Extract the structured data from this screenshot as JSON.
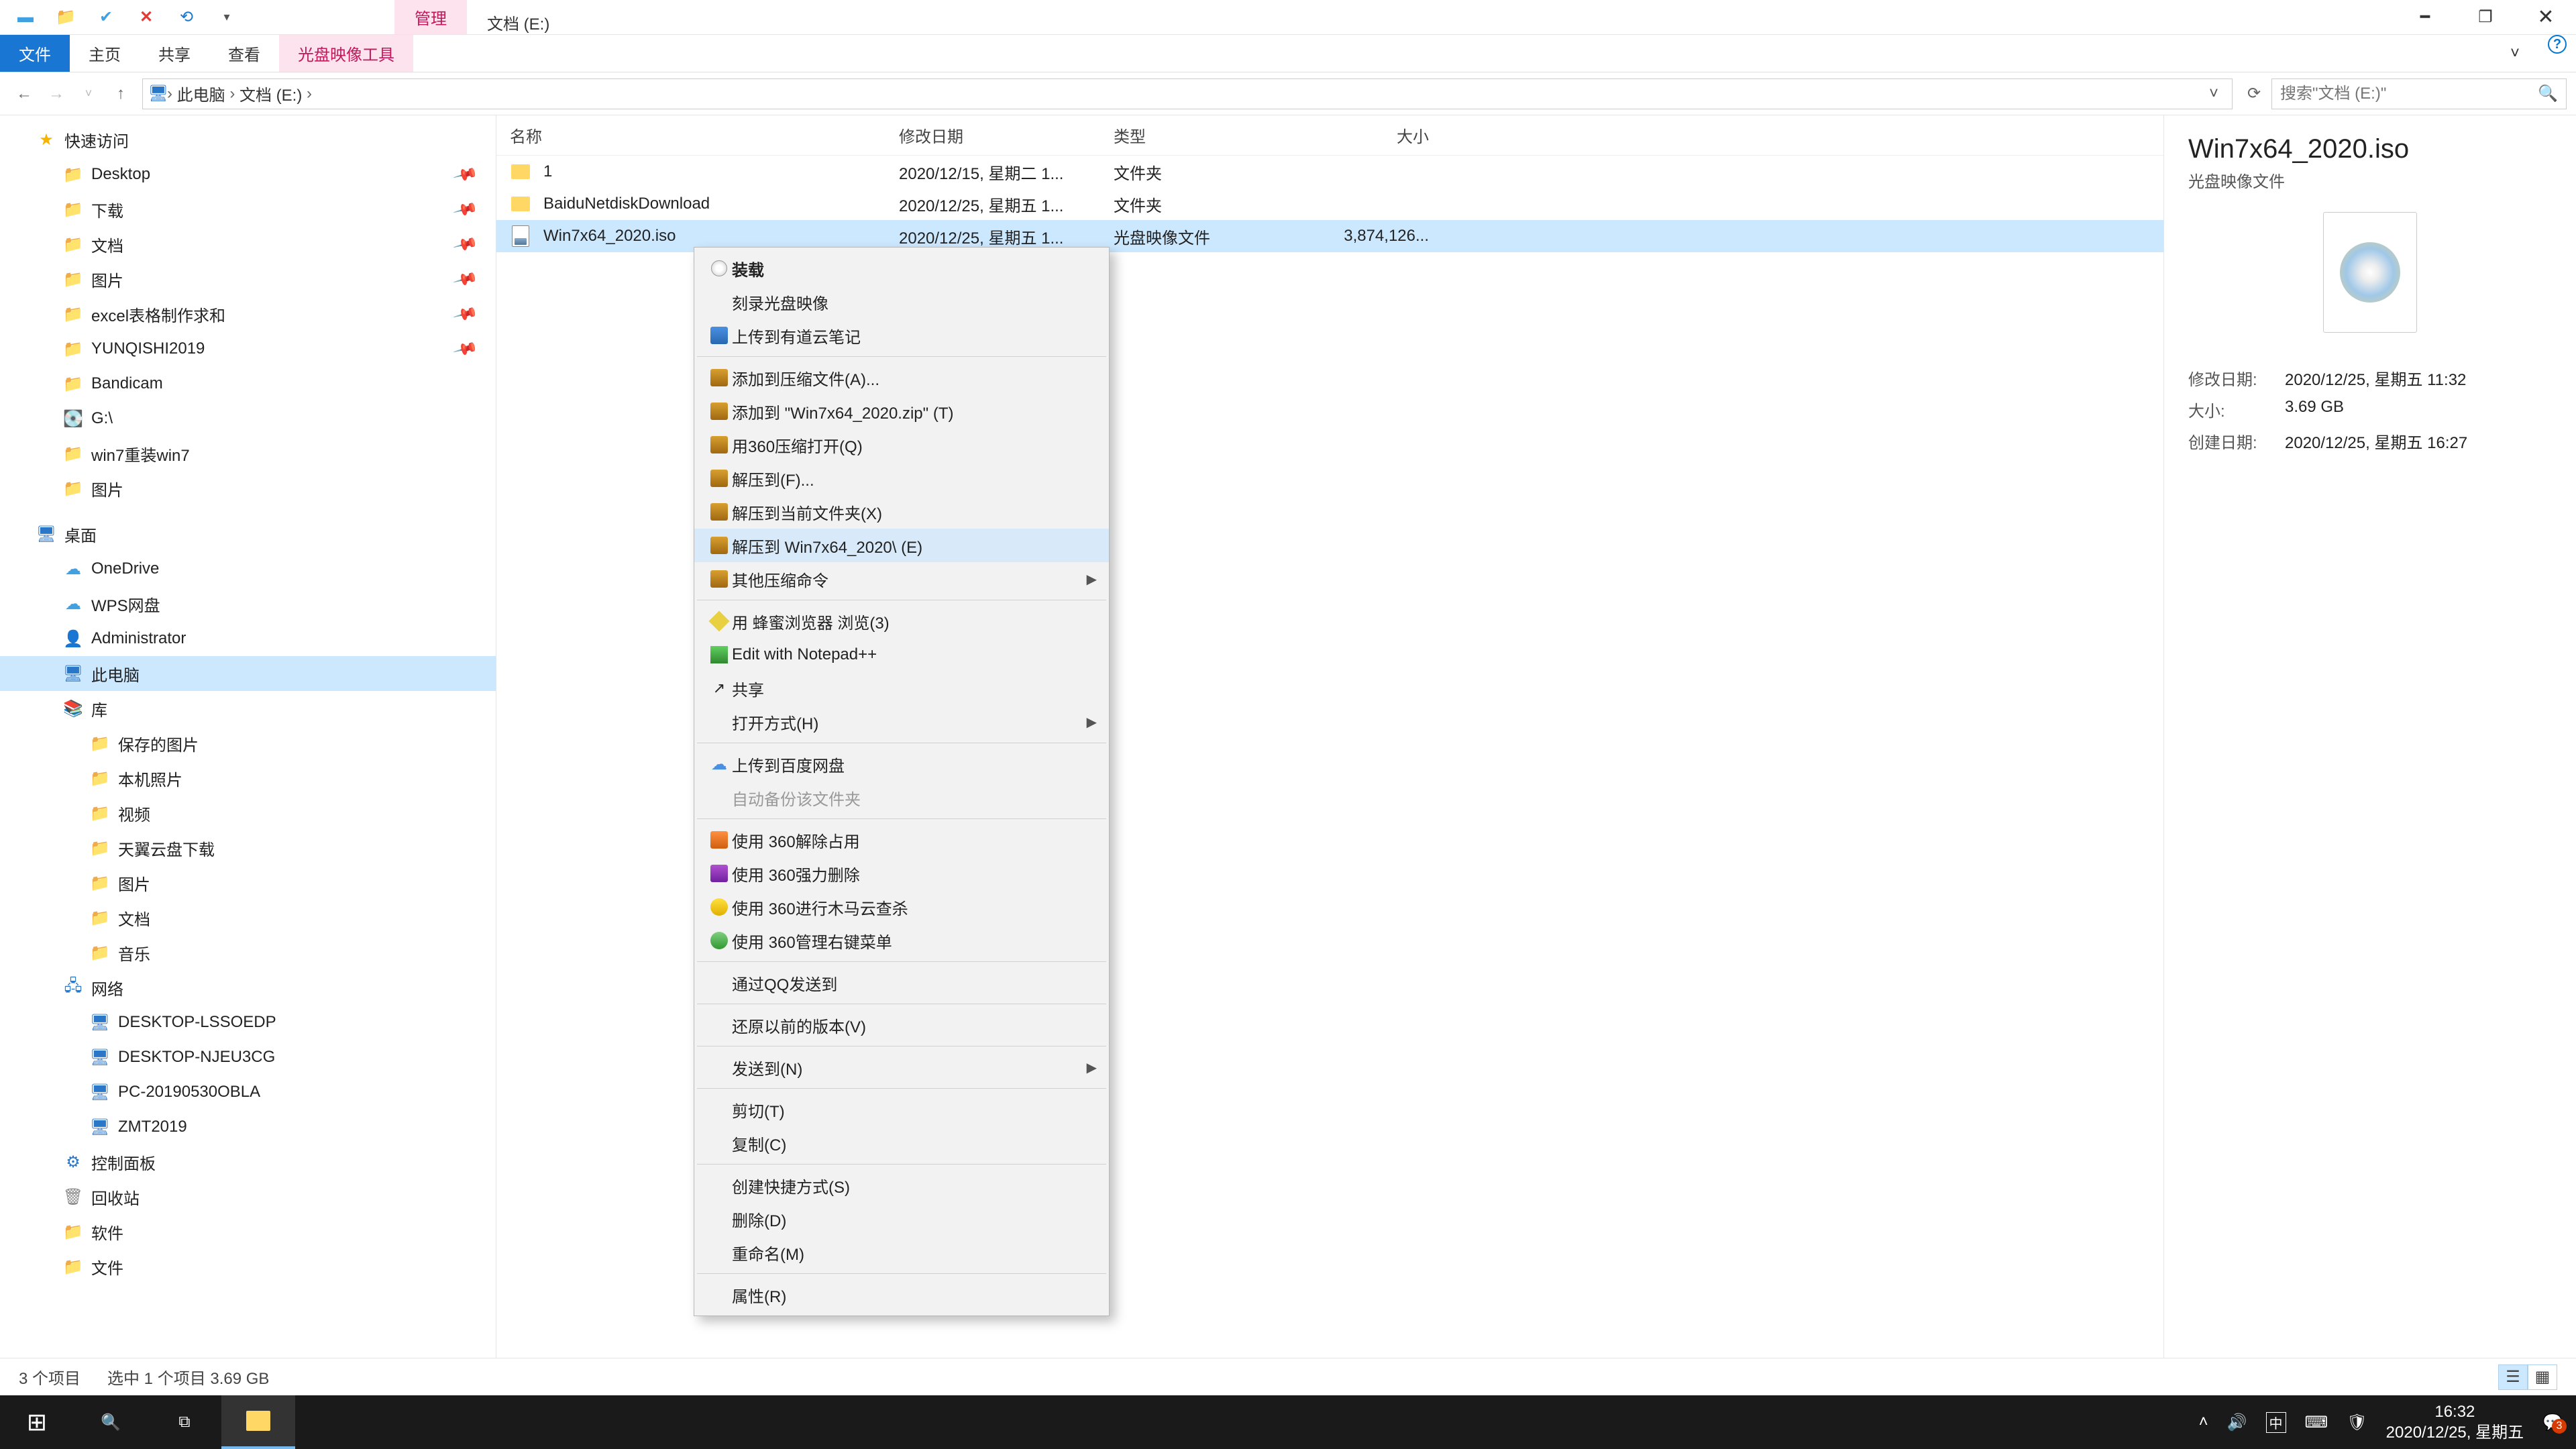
{
  "title": "文档 (E:)",
  "context_tab": "管理",
  "ribbon": {
    "file": "文件",
    "home": "主页",
    "share": "共享",
    "view": "查看",
    "disc": "光盘映像工具"
  },
  "breadcrumb": {
    "pc": "此电脑",
    "drive": "文档 (E:)"
  },
  "search_placeholder": "搜索\"文档 (E:)\"",
  "columns": {
    "name": "名称",
    "date": "修改日期",
    "type": "类型",
    "size": "大小"
  },
  "files": [
    {
      "name": "1",
      "date": "2020/12/15, 星期二 1...",
      "type": "文件夹",
      "size": "",
      "icon": "folder"
    },
    {
      "name": "BaiduNetdiskDownload",
      "date": "2020/12/25, 星期五 1...",
      "type": "文件夹",
      "size": "",
      "icon": "folder"
    },
    {
      "name": "Win7x64_2020.iso",
      "date": "2020/12/25, 星期五 1...",
      "type": "光盘映像文件",
      "size": "3,874,126...",
      "icon": "iso",
      "sel": true
    }
  ],
  "sidebar": [
    {
      "t": "快速访问",
      "ic": "star",
      "l": 1
    },
    {
      "t": "Desktop",
      "ic": "fold",
      "l": 2,
      "pin": true
    },
    {
      "t": "下载",
      "ic": "fold",
      "l": 2,
      "pin": true
    },
    {
      "t": "文档",
      "ic": "fold",
      "l": 2,
      "pin": true
    },
    {
      "t": "图片",
      "ic": "fold",
      "l": 2,
      "pin": true
    },
    {
      "t": "excel表格制作求和",
      "ic": "fold",
      "l": 2,
      "pin": true
    },
    {
      "t": "YUNQISHI2019",
      "ic": "fold",
      "l": 2,
      "pin": true
    },
    {
      "t": "Bandicam",
      "ic": "fold",
      "l": 2
    },
    {
      "t": "G:\\",
      "ic": "disk",
      "l": 2
    },
    {
      "t": "win7重装win7",
      "ic": "fold",
      "l": 2
    },
    {
      "t": "图片",
      "ic": "fold",
      "l": 2
    },
    {
      "t": "",
      "ic": "",
      "l": 0
    },
    {
      "t": "桌面",
      "ic": "mon",
      "l": 1
    },
    {
      "t": "OneDrive",
      "ic": "cloud",
      "l": 2
    },
    {
      "t": "WPS网盘",
      "ic": "cloud",
      "l": 2
    },
    {
      "t": "Administrator",
      "ic": "user",
      "l": 2
    },
    {
      "t": "此电脑",
      "ic": "mon",
      "l": 2,
      "sel": true
    },
    {
      "t": "库",
      "ic": "lib",
      "l": 2
    },
    {
      "t": "保存的图片",
      "ic": "fold",
      "l": 2,
      "x": 1
    },
    {
      "t": "本机照片",
      "ic": "fold",
      "l": 2,
      "x": 1
    },
    {
      "t": "视频",
      "ic": "fold",
      "l": 2,
      "x": 1
    },
    {
      "t": "天翼云盘下载",
      "ic": "fold",
      "l": 2,
      "x": 1
    },
    {
      "t": "图片",
      "ic": "fold",
      "l": 2,
      "x": 1
    },
    {
      "t": "文档",
      "ic": "fold",
      "l": 2,
      "x": 1
    },
    {
      "t": "音乐",
      "ic": "fold",
      "l": 2,
      "x": 1
    },
    {
      "t": "网络",
      "ic": "net",
      "l": 2
    },
    {
      "t": "DESKTOP-LSSOEDP",
      "ic": "mon",
      "l": 2,
      "x": 1
    },
    {
      "t": "DESKTOP-NJEU3CG",
      "ic": "mon",
      "l": 2,
      "x": 1
    },
    {
      "t": "PC-20190530OBLA",
      "ic": "mon",
      "l": 2,
      "x": 1
    },
    {
      "t": "ZMT2019",
      "ic": "mon",
      "l": 2,
      "x": 1
    },
    {
      "t": "控制面板",
      "ic": "cp",
      "l": 2
    },
    {
      "t": "回收站",
      "ic": "bin",
      "l": 2
    },
    {
      "t": "软件",
      "ic": "fold",
      "l": 2
    },
    {
      "t": "文件",
      "ic": "fold",
      "l": 2
    }
  ],
  "details": {
    "title": "Win7x64_2020.iso",
    "sub": "光盘映像文件",
    "mod_l": "修改日期:",
    "mod_v": "2020/12/25, 星期五 11:32",
    "size_l": "大小:",
    "size_v": "3.69 GB",
    "cre_l": "创建日期:",
    "cre_v": "2020/12/25, 星期五 16:27"
  },
  "ctx": [
    {
      "t": "装载",
      "ic": "disc",
      "bold": true
    },
    {
      "t": "刻录光盘映像"
    },
    {
      "t": "上传到有道云笔记",
      "ic": "blue"
    },
    {
      "sep": true
    },
    {
      "t": "添加到压缩文件(A)...",
      "ic": "zip"
    },
    {
      "t": "添加到 \"Win7x64_2020.zip\" (T)",
      "ic": "zip"
    },
    {
      "t": "用360压缩打开(Q)",
      "ic": "zip"
    },
    {
      "t": "解压到(F)...",
      "ic": "zip"
    },
    {
      "t": "解压到当前文件夹(X)",
      "ic": "zip"
    },
    {
      "t": "解压到 Win7x64_2020\\ (E)",
      "ic": "zip",
      "hover": true
    },
    {
      "t": "其他压缩命令",
      "ic": "zip",
      "arr": true
    },
    {
      "sep": true
    },
    {
      "t": "用 蜂蜜浏览器 浏览(3)",
      "ic": "honey"
    },
    {
      "t": "Edit with Notepad++",
      "ic": "edit"
    },
    {
      "t": "共享",
      "ic": "share"
    },
    {
      "t": "打开方式(H)",
      "arr": true
    },
    {
      "sep": true
    },
    {
      "t": "上传到百度网盘",
      "ic": "cloud"
    },
    {
      "t": "自动备份该文件夹",
      "dis": true
    },
    {
      "sep": true
    },
    {
      "t": "使用 360解除占用",
      "ic": "360o"
    },
    {
      "t": "使用 360强力删除",
      "ic": "pur"
    },
    {
      "t": "使用 360进行木马云查杀",
      "ic": "360y"
    },
    {
      "t": "使用 360管理右键菜单",
      "ic": "360"
    },
    {
      "sep": true
    },
    {
      "t": "通过QQ发送到"
    },
    {
      "sep": true
    },
    {
      "t": "还原以前的版本(V)"
    },
    {
      "sep": true
    },
    {
      "t": "发送到(N)",
      "arr": true
    },
    {
      "sep": true
    },
    {
      "t": "剪切(T)"
    },
    {
      "t": "复制(C)"
    },
    {
      "sep": true
    },
    {
      "t": "创建快捷方式(S)"
    },
    {
      "t": "删除(D)"
    },
    {
      "t": "重命名(M)"
    },
    {
      "sep": true
    },
    {
      "t": "属性(R)"
    }
  ],
  "status": {
    "count": "3 个项目",
    "sel": "选中 1 个项目  3.69 GB"
  },
  "tray": {
    "ime": "中",
    "time": "16:32",
    "date": "2020/12/25, 星期五",
    "notif": "3"
  }
}
